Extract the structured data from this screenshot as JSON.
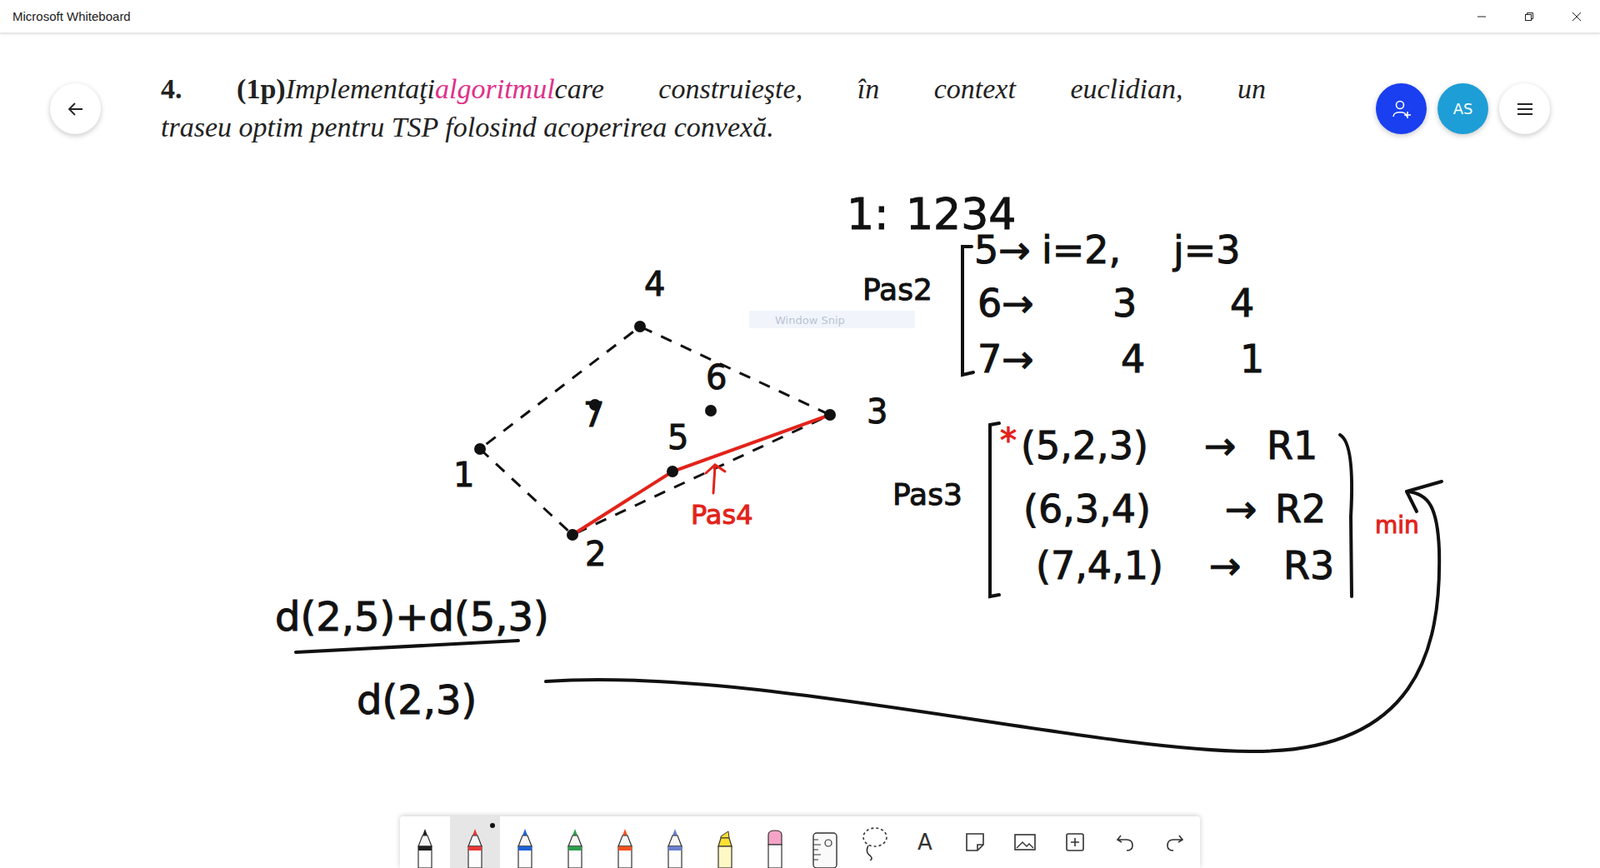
{
  "window": {
    "title": "Microsoft Whiteboard"
  },
  "header": {
    "avatar": "AS",
    "problem": {
      "number": "4.",
      "points": "(1p)",
      "lines": [
        [
          {
            "text": "Implementaţi",
            "highlight": false
          },
          {
            "text": "algoritmul",
            "highlight": true
          },
          {
            "text": "care construieşte, în context euclidian, un",
            "highlight": false
          }
        ],
        [
          {
            "text": "traseu optim pentru TSP folosind acoperirea convexă.",
            "highlight": false
          }
        ]
      ]
    }
  },
  "board": {
    "points": [
      {
        "label": "1"
      },
      {
        "label": "2"
      },
      {
        "label": "3"
      },
      {
        "label": "4"
      },
      {
        "label": "5"
      },
      {
        "label": "6"
      },
      {
        "label": "7"
      }
    ],
    "hull": [
      "1",
      "2",
      "3",
      "4"
    ],
    "route": [
      "2",
      "5",
      "3"
    ],
    "step1": {
      "label": "1:",
      "order": "1234"
    },
    "step2": {
      "label": "Pas2",
      "rows": [
        {
          "point": "5→",
          "i": "i=2,",
          "j": "j=3"
        },
        {
          "point": "6→",
          "i": "3",
          "j": "4"
        },
        {
          "point": "7→",
          "i": "4",
          "j": "1"
        }
      ]
    },
    "step3": {
      "label": "Pas3",
      "marker": "*",
      "pick": "min",
      "rows": [
        {
          "triple": "(5,2,3)",
          "arrow": "→",
          "result": "R1",
          "selected": true
        },
        {
          "triple": "(6,3,4)",
          "arrow": "→",
          "result": "R2",
          "selected": false
        },
        {
          "triple": "(7,4,1)",
          "arrow": "→",
          "result": "R3",
          "selected": false
        }
      ]
    },
    "step4": {
      "label": "Pas4"
    },
    "ratio": {
      "numerator": "d(2,5)+d(5,3)",
      "denominator": "d(2,3)"
    },
    "watermark": "Window Snip"
  },
  "toolbar": {
    "tools": [
      {
        "kind": "pen",
        "color": "#1f1f1f",
        "selected": false
      },
      {
        "kind": "pen",
        "color": "#e53935",
        "selected": true
      },
      {
        "kind": "pen",
        "color": "#1e63d6",
        "selected": false
      },
      {
        "kind": "pen",
        "color": "#2e9e4f",
        "selected": false
      },
      {
        "kind": "pen",
        "color": "#f4511e",
        "selected": false
      },
      {
        "kind": "pen",
        "color": "#6a7fd0",
        "selected": false
      },
      {
        "kind": "highlighter",
        "color": "#ffe033",
        "selected": false
      },
      {
        "kind": "eraser",
        "color": "#f5a3c7",
        "selected": false
      },
      {
        "kind": "ruler",
        "selected": false
      },
      {
        "kind": "lasso",
        "selected": false
      },
      {
        "kind": "text",
        "label": "A",
        "selected": false
      },
      {
        "kind": "note",
        "selected": false
      },
      {
        "kind": "image",
        "selected": false
      },
      {
        "kind": "insert",
        "selected": false
      },
      {
        "kind": "undo",
        "selected": false
      },
      {
        "kind": "redo",
        "selected": false
      }
    ]
  }
}
